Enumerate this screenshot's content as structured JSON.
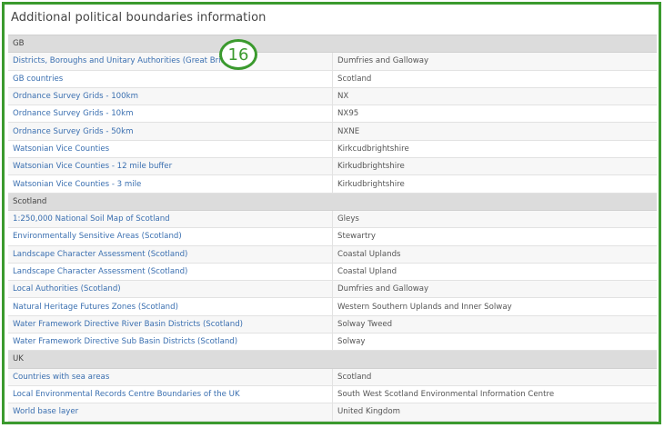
{
  "panel": {
    "title": "Additional political boundaries information"
  },
  "badge": "16",
  "groups": [
    {
      "name": "GB",
      "rows": [
        {
          "name": "Districts, Boroughs and Unitary Authorities (Great Britain)",
          "value": "Dumfries and Galloway"
        },
        {
          "name": "GB countries",
          "value": "Scotland"
        },
        {
          "name": "Ordnance Survey Grids - 100km",
          "value": "NX"
        },
        {
          "name": "Ordnance Survey Grids - 10km",
          "value": "NX95"
        },
        {
          "name": "Ordnance Survey Grids - 50km",
          "value": "NXNE"
        },
        {
          "name": "Watsonian Vice Counties",
          "value": "Kirkcudbrightshire"
        },
        {
          "name": "Watsonian Vice Counties - 12 mile buffer",
          "value": "Kirkudbrightshire"
        },
        {
          "name": "Watsonian Vice Counties - 3 mile",
          "value": "Kirkudbrightshire"
        }
      ]
    },
    {
      "name": "Scotland",
      "rows": [
        {
          "name": "1:250,000 National Soil Map of Scotland",
          "value": "Gleys"
        },
        {
          "name": "Environmentally Sensitive Areas (Scotland)",
          "value": "Stewartry"
        },
        {
          "name": "Landscape Character Assessment (Scotland)",
          "value": "Coastal Uplands"
        },
        {
          "name": "Landscape Character Assessment (Scotland)",
          "value": "Coastal Upland"
        },
        {
          "name": "Local Authorities (Scotland)",
          "value": "Dumfries and Galloway"
        },
        {
          "name": "Natural Heritage Futures Zones (Scotland)",
          "value": "Western Southern Uplands and Inner Solway"
        },
        {
          "name": "Water Framework Directive River Basin Districts (Scotland)",
          "value": "Solway Tweed"
        },
        {
          "name": "Water Framework Directive Sub Basin Districts (Scotland)",
          "value": "Solway"
        }
      ]
    },
    {
      "name": "UK",
      "rows": [
        {
          "name": "Countries with sea areas",
          "value": "Scotland"
        },
        {
          "name": "Local Environmental Records Centre Boundaries of the UK",
          "value": "South West Scotland Environmental Information Centre"
        },
        {
          "name": "World base layer",
          "value": "United Kingdom"
        }
      ]
    }
  ]
}
